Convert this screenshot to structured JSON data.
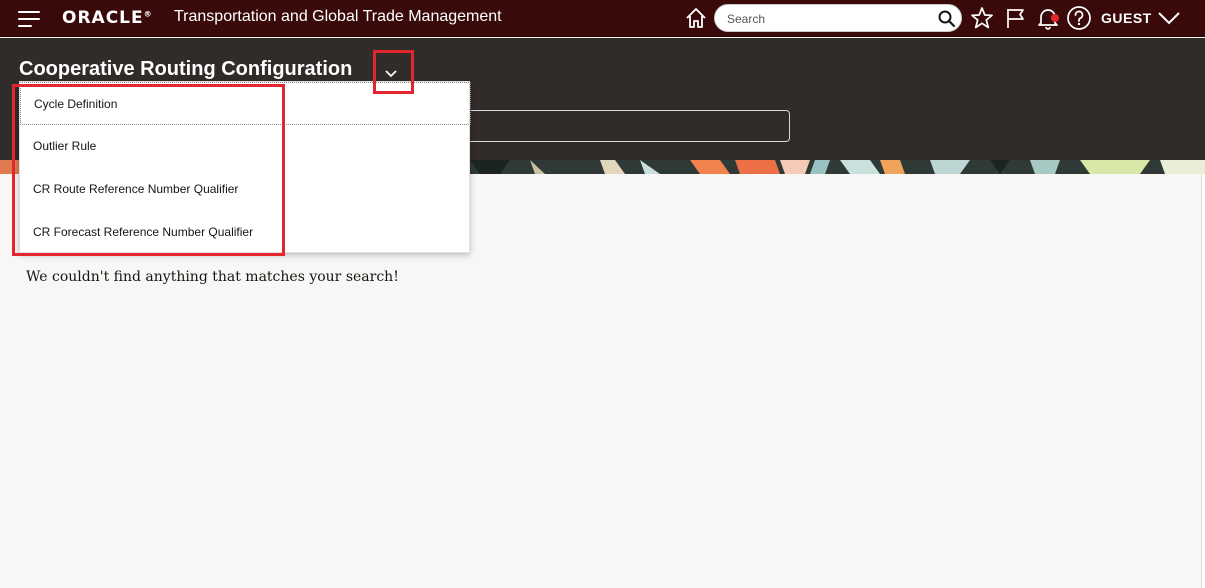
{
  "topbar": {
    "logo": "ORACLE",
    "logo_mark": "®",
    "app_title": "Transportation and Global Trade Management",
    "search_placeholder": "Search",
    "user": "GUEST",
    "icons": [
      "hamburger-icon",
      "home-icon",
      "search-icon",
      "star-icon",
      "flag-icon",
      "bell-icon",
      "help-icon",
      "chevron-down-icon"
    ],
    "notification_dot_color": "#e3262d"
  },
  "header": {
    "title": "Cooperative Routing Configuration"
  },
  "dropdown": {
    "items": [
      {
        "label": "Cycle Definition"
      },
      {
        "label": "Outlier Rule"
      },
      {
        "label": "CR Route Reference Number Qualifier"
      },
      {
        "label": "CR Forecast Reference Number Qualifier"
      }
    ]
  },
  "main": {
    "message": "We couldn't find anything that matches your search!"
  },
  "colors": {
    "topbar": "#3a0a0a",
    "header": "#312c29",
    "highlight": "#e3262d",
    "background": "#f9f7f5"
  }
}
